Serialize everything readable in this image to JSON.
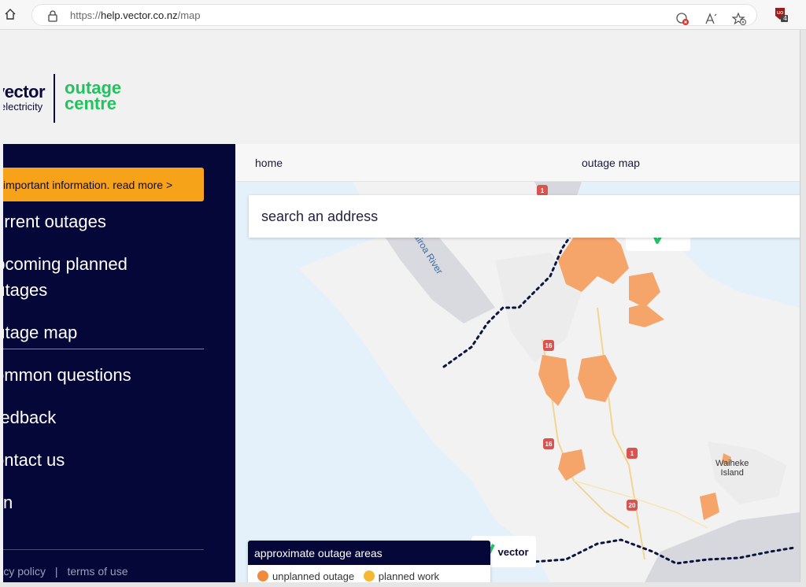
{
  "browser": {
    "url_base": "https://",
    "url_host": "help.vector.co.nz",
    "url_path": "/map",
    "extension_badge": "4"
  },
  "logo": {
    "brand_word": "vector",
    "sub_word": "electricity",
    "outage_line1": "outage",
    "outage_line2": "centre"
  },
  "sidebar": {
    "notice": "important information. read more >",
    "items": [
      {
        "label": "current outages"
      },
      {
        "label_line1": "upcoming planned",
        "label_line2": "outages"
      },
      {
        "label": "outage map"
      },
      {
        "label": "common questions"
      },
      {
        "label": "feedback"
      },
      {
        "label": "contact us"
      },
      {
        "label": "join"
      }
    ],
    "footer_privacy": "privacy policy",
    "footer_sep": "|",
    "footer_terms": "terms of use"
  },
  "topnav": {
    "home": "home",
    "outage_map": "outage map"
  },
  "map": {
    "search_placeholder": "search an address",
    "river_label": "Wairoa River",
    "island_line1": "Waiheke",
    "island_line2": "Island",
    "route_1": "1",
    "route_16a": "16",
    "route_16b": "16",
    "route_1b": "1",
    "route_20": "20",
    "route_1top": "1",
    "vector_badge": "vector",
    "legend_title": "approximate outage areas",
    "legend_unplanned": "unplanned outage",
    "legend_planned": "planned work",
    "colors": {
      "outage_fill": "#f5a46a",
      "unplanned": "#f08a3c",
      "planned": "#f6b833",
      "boundary": "#0b1540",
      "water": "#e4f1fb",
      "land": "#f2f2f2"
    }
  }
}
